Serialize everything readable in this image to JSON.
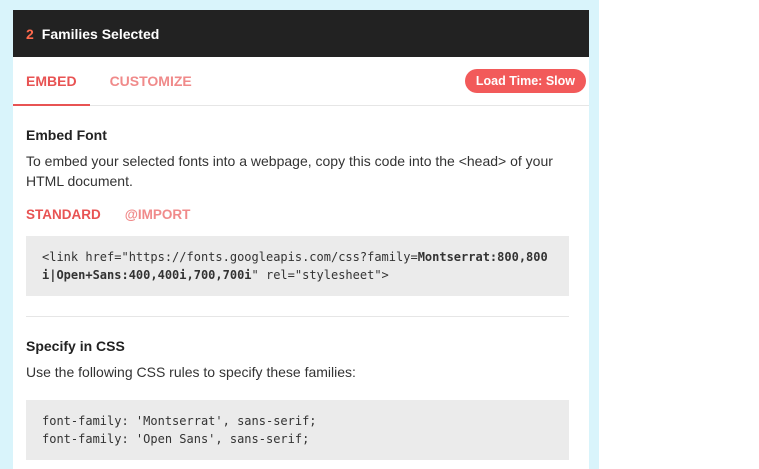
{
  "header": {
    "count": "2",
    "title": "Families Selected"
  },
  "tabs": [
    {
      "label": "EMBED",
      "active": true
    },
    {
      "label": "CUSTOMIZE",
      "active": false
    }
  ],
  "load_badge": "Load Time: Slow",
  "embed": {
    "title": "Embed Font",
    "desc_line1": "To embed your selected fonts into a webpage, copy this code into the <head> of your",
    "desc_line2": "HTML document.",
    "subtabs": [
      {
        "label": "STANDARD",
        "active": true
      },
      {
        "label": "@IMPORT",
        "active": false
      }
    ],
    "code_prefix": "<link href=\"https://fonts.googleapis.com/css?family=",
    "code_bold1": "Montserrat:800,800",
    "code_bold2": "i|Open+Sans:400,400i,700,700i",
    "code_suffix": "\" rel=\"stylesheet\">"
  },
  "css": {
    "title": "Specify in CSS",
    "desc": "Use the following CSS rules to specify these families:",
    "rule1": "font-family: 'Montserrat', sans-serif;",
    "rule2": "font-family: 'Open Sans', sans-serif;"
  },
  "colors": {
    "accent": "#e85353",
    "topbar": "#222222",
    "backdrop": "#d9f4fb"
  }
}
